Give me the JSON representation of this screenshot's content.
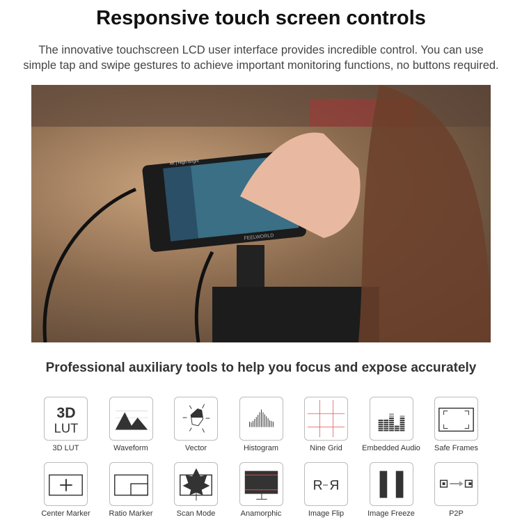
{
  "header": {
    "title": "Responsive touch screen controls",
    "subtitle_line1": "The innovative touchscreen LCD user interface provides incredible control. You can use",
    "subtitle_line2": "simple tap and swipe gestures to achieve important monitoring functions, no buttons required."
  },
  "photo": {
    "brand": "FEELWORLD",
    "screen_label": "4K | High-Bright"
  },
  "tools": {
    "heading": "Professional auxiliary tools to help you focus and expose accurately",
    "items": [
      {
        "label": "3D LUT",
        "icon": "3d-lut-icon",
        "glyph_top": "3D",
        "glyph_bottom": "LUT"
      },
      {
        "label": "Waveform",
        "icon": "waveform-icon"
      },
      {
        "label": "Vector",
        "icon": "vector-icon"
      },
      {
        "label": "Histogram",
        "icon": "histogram-icon"
      },
      {
        "label": "Nine Grid",
        "icon": "nine-grid-icon"
      },
      {
        "label": "Embedded Audio",
        "icon": "audio-meter-icon"
      },
      {
        "label": "Safe Frames",
        "icon": "safe-frames-icon"
      },
      {
        "label": "Center Marker",
        "icon": "center-marker-icon"
      },
      {
        "label": "Ratio Marker",
        "icon": "ratio-marker-icon"
      },
      {
        "label": "Scan Mode",
        "icon": "scan-mode-icon"
      },
      {
        "label": "Anamorphic",
        "icon": "anamorphic-icon"
      },
      {
        "label": "Image Flip",
        "icon": "image-flip-icon"
      },
      {
        "label": "Image Freeze",
        "icon": "image-freeze-icon"
      },
      {
        "label": "P2P",
        "icon": "p2p-icon"
      }
    ]
  },
  "colors": {
    "grid_red": "#e05050",
    "icon_dark": "#333333"
  }
}
